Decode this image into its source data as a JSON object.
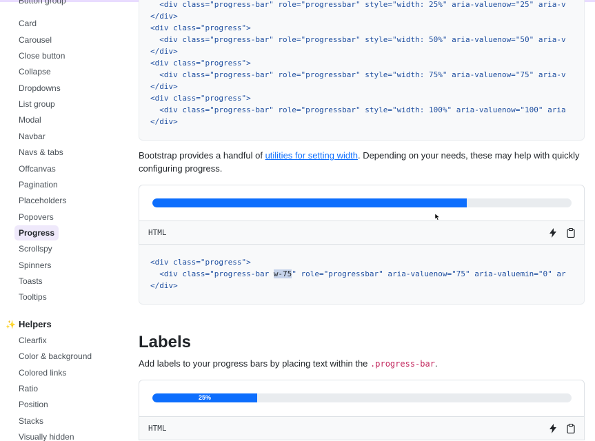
{
  "sidebar": {
    "items": [
      "Button group",
      "Card",
      "Carousel",
      "Close button",
      "Collapse",
      "Dropdowns",
      "List group",
      "Modal",
      "Navbar",
      "Navs & tabs",
      "Offcanvas",
      "Pagination",
      "Placeholders",
      "Popovers",
      "Progress",
      "Scrollspy",
      "Spinners",
      "Toasts",
      "Tooltips"
    ],
    "active": "Progress",
    "helpers_title": "Helpers",
    "helpers_items": [
      "Clearfix",
      "Color & background",
      "Colored links",
      "Ratio",
      "Position",
      "Stacks",
      "Visually hidden"
    ]
  },
  "colors": {
    "accent_purple": "#efe9fb",
    "primary_blue": "#0d6efd",
    "track_gray": "#e9ecef",
    "inline_code": "#c2255c"
  },
  "code_top": {
    "lines": [
      [
        "  ",
        "<div class=\"progress-bar\" role=\"progressbar\" style=\"width: 25%\" aria-valuenow=\"25\" aria-v"
      ],
      [
        "",
        "</div>"
      ],
      [
        "",
        "<div class=\"progress\">"
      ],
      [
        "  ",
        "<div class=\"progress-bar\" role=\"progressbar\" style=\"width: 50%\" aria-valuenow=\"50\" aria-v"
      ],
      [
        "",
        "</div>"
      ],
      [
        "",
        "<div class=\"progress\">"
      ],
      [
        "  ",
        "<div class=\"progress-bar\" role=\"progressbar\" style=\"width: 75%\" aria-valuenow=\"75\" aria-v"
      ],
      [
        "",
        "</div>"
      ],
      [
        "",
        "<div class=\"progress\">"
      ],
      [
        "  ",
        "<div class=\"progress-bar\" role=\"progressbar\" style=\"width: 100%\" aria-valuenow=\"100\" aria"
      ],
      [
        "",
        "</div>"
      ]
    ]
  },
  "width_para": {
    "before": "Bootstrap provides a handful of ",
    "link": "utilities for setting width",
    "after": ". Depending on your needs, these may help with quickly configuring progress."
  },
  "example1": {
    "progress": 75
  },
  "html_label": "HTML",
  "icons": {
    "run": "lightning-icon",
    "copy": "clipboard-icon"
  },
  "code_mid": {
    "line1": "<div class=\"progress\">",
    "line2_pre": "  <div class=\"progress-bar ",
    "line2_hl": "w-75",
    "line2_post": "\" role=\"progressbar\" aria-valuenow=\"75\" aria-valuemin=\"0\" ar",
    "line3": "</div>"
  },
  "labels": {
    "heading": "Labels",
    "para_before": "Add labels to your progress bars by placing text within the ",
    "para_code": ".progress-bar",
    "para_after": "."
  },
  "example2": {
    "progress": 25,
    "label": "25%"
  }
}
